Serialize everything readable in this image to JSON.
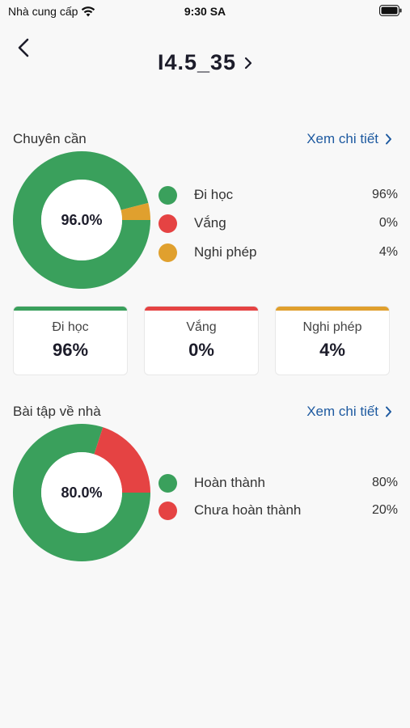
{
  "status_bar": {
    "carrier": "Nhà cung cấp",
    "time": "9:30 SA"
  },
  "header": {
    "title": "I4.5_35"
  },
  "attendance": {
    "section_title": "Chuyên cần",
    "detail_link": "Xem chi tiết",
    "center_label": "96.0%",
    "legend": [
      {
        "label": "Đi học",
        "value": "96%",
        "color": "#3aa05c"
      },
      {
        "label": "Vắng",
        "value": "0%",
        "color": "#e54343"
      },
      {
        "label": "Nghi phép",
        "value": "4%",
        "color": "#e0a02e"
      }
    ],
    "cards": [
      {
        "label": "Đi học",
        "value": "96%",
        "color": "#3aa05c"
      },
      {
        "label": "Vắng",
        "value": "0%",
        "color": "#e54343"
      },
      {
        "label": "Nghi phép",
        "value": "4%",
        "color": "#e0a02e"
      }
    ]
  },
  "homework": {
    "section_title": "Bài tập về nhà",
    "detail_link": "Xem chi tiết",
    "center_label": "80.0%",
    "legend": [
      {
        "label": "Hoàn thành",
        "value": "80%",
        "color": "#3aa05c"
      },
      {
        "label": "Chưa hoàn thành",
        "value": "20%",
        "color": "#e54343"
      }
    ]
  },
  "chart_data": [
    {
      "type": "pie",
      "categories": [
        "Đi học",
        "Vắng",
        "Nghi phép"
      ],
      "values": [
        96,
        0,
        4
      ],
      "colors": [
        "#3aa05c",
        "#e54343",
        "#e0a02e"
      ]
    },
    {
      "type": "pie",
      "categories": [
        "Hoàn thành",
        "Chưa hoàn thành"
      ],
      "values": [
        80,
        20
      ],
      "colors": [
        "#3aa05c",
        "#e54343"
      ]
    }
  ]
}
